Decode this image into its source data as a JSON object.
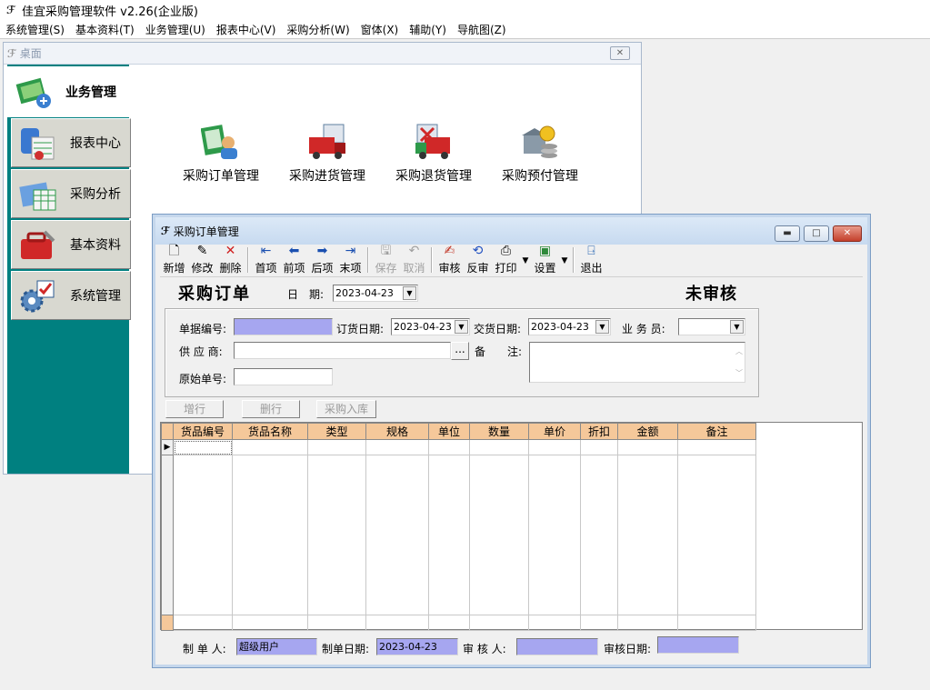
{
  "app": {
    "title": "佳宜采购管理软件 v2.26(企业版)"
  },
  "menu": [
    "系统管理(S)",
    "基本资料(T)",
    "业务管理(U)",
    "报表中心(V)",
    "采购分析(W)",
    "窗体(X)",
    "辅助(Y)",
    "导航图(Z)"
  ],
  "desktop": {
    "title": "桌面",
    "nav": [
      {
        "label": "业务管理",
        "icon": "business-icon",
        "active": true
      },
      {
        "label": "报表中心",
        "icon": "report-icon"
      },
      {
        "label": "采购分析",
        "icon": "analysis-icon"
      },
      {
        "label": "基本资料",
        "icon": "toolbox-icon"
      },
      {
        "label": "系统管理",
        "icon": "settings-icon"
      }
    ],
    "modules": [
      {
        "label": "采购订单管理",
        "icon": "purchase-order-icon"
      },
      {
        "label": "采购进货管理",
        "icon": "truck-in-icon"
      },
      {
        "label": "采购退货管理",
        "icon": "truck-return-icon"
      },
      {
        "label": "采购预付管理",
        "icon": "prepay-coins-icon"
      }
    ]
  },
  "order_window": {
    "title": "采购订单管理",
    "toolbar": {
      "new": "新增",
      "edit": "修改",
      "delete": "删除",
      "first": "首项",
      "prev": "前项",
      "next": "后项",
      "last": "末项",
      "save": "保存",
      "cancel": "取消",
      "approve": "审核",
      "unapprove": "反审",
      "print": "打印",
      "settings": "设置",
      "exit": "退出"
    },
    "heading": "采购订单",
    "date_label": "日　期:",
    "date_value": "2023-04-23",
    "status": "未审核",
    "fields": {
      "doc_no_label": "单据编号:",
      "doc_no_value": "",
      "order_date_label": "订货日期:",
      "order_date_value": "2023-04-23",
      "delivery_date_label": "交货日期:",
      "delivery_date_value": "2023-04-23",
      "salesman_label": "业 务 员:",
      "salesman_value": "",
      "supplier_label": "供 应 商:",
      "supplier_value": "",
      "browse_label": "...",
      "remark_label": "备　　注:",
      "remark_value": "",
      "orig_no_label": "原始单号:",
      "orig_no_value": ""
    },
    "row_buttons": {
      "add": "增行",
      "delete": "删行",
      "stock_in": "采购入库"
    },
    "columns": [
      "货品编号",
      "货品名称",
      "类型",
      "规格",
      "单位",
      "数量",
      "单价",
      "折扣",
      "金额",
      "备注"
    ],
    "footer": {
      "maker_label": "制 单 人:",
      "maker_value": "超级用户",
      "make_date_label": "制单日期:",
      "make_date_value": "2023-04-23",
      "auditor_label": "审 核 人:",
      "auditor_value": "",
      "audit_date_label": "审核日期:",
      "audit_date_value": ""
    }
  },
  "colors": {
    "teal": "#008080",
    "header_orange": "#f5c89a",
    "field_purple": "#a6a6f0"
  }
}
